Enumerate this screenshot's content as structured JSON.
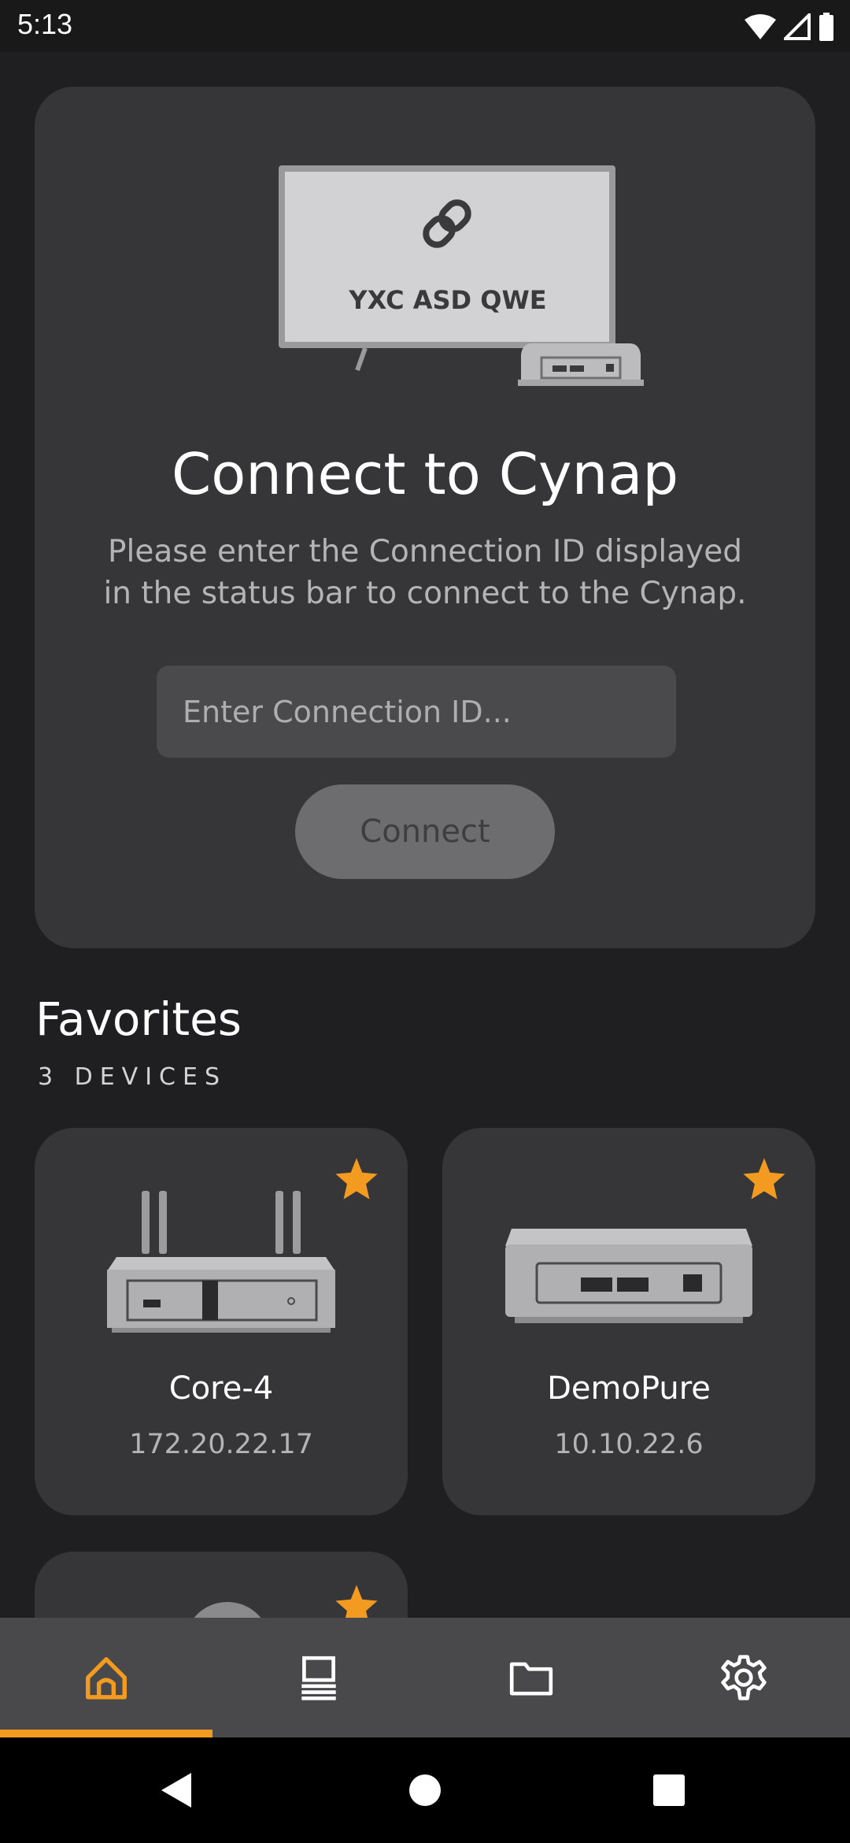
{
  "status": {
    "time": "5:13"
  },
  "connect": {
    "hero_code": "YXC ASD QWE",
    "title": "Connect to Cynap",
    "description": "Please enter the Connection ID displayed in the status bar to connect to the Cynap.",
    "input_placeholder": "Enter Connection ID...",
    "input_value": "",
    "button_label": "Connect"
  },
  "favorites": {
    "title": "Favorites",
    "count_label": "3 DEVICES",
    "devices": [
      {
        "name": "Core-4",
        "ip": "172.20.22.17",
        "favorite": true,
        "icon": "cynap-core-router-icon"
      },
      {
        "name": "DemoPure",
        "ip": "10.10.22.6",
        "favorite": true,
        "icon": "cynap-pure-box-icon"
      },
      {
        "name": "",
        "ip": "",
        "favorite": true,
        "icon": "device-thumbnail"
      }
    ]
  },
  "bottom_nav": {
    "items": [
      {
        "name": "home",
        "icon": "home-icon",
        "active": true
      },
      {
        "name": "devices",
        "icon": "device-list-icon",
        "active": false
      },
      {
        "name": "files",
        "icon": "folder-icon",
        "active": false
      },
      {
        "name": "settings",
        "icon": "gear-icon",
        "active": false
      }
    ]
  },
  "colors": {
    "accent": "#f39a21",
    "background": "#1f1f21",
    "card": "#363638",
    "nav": "#49494b"
  }
}
